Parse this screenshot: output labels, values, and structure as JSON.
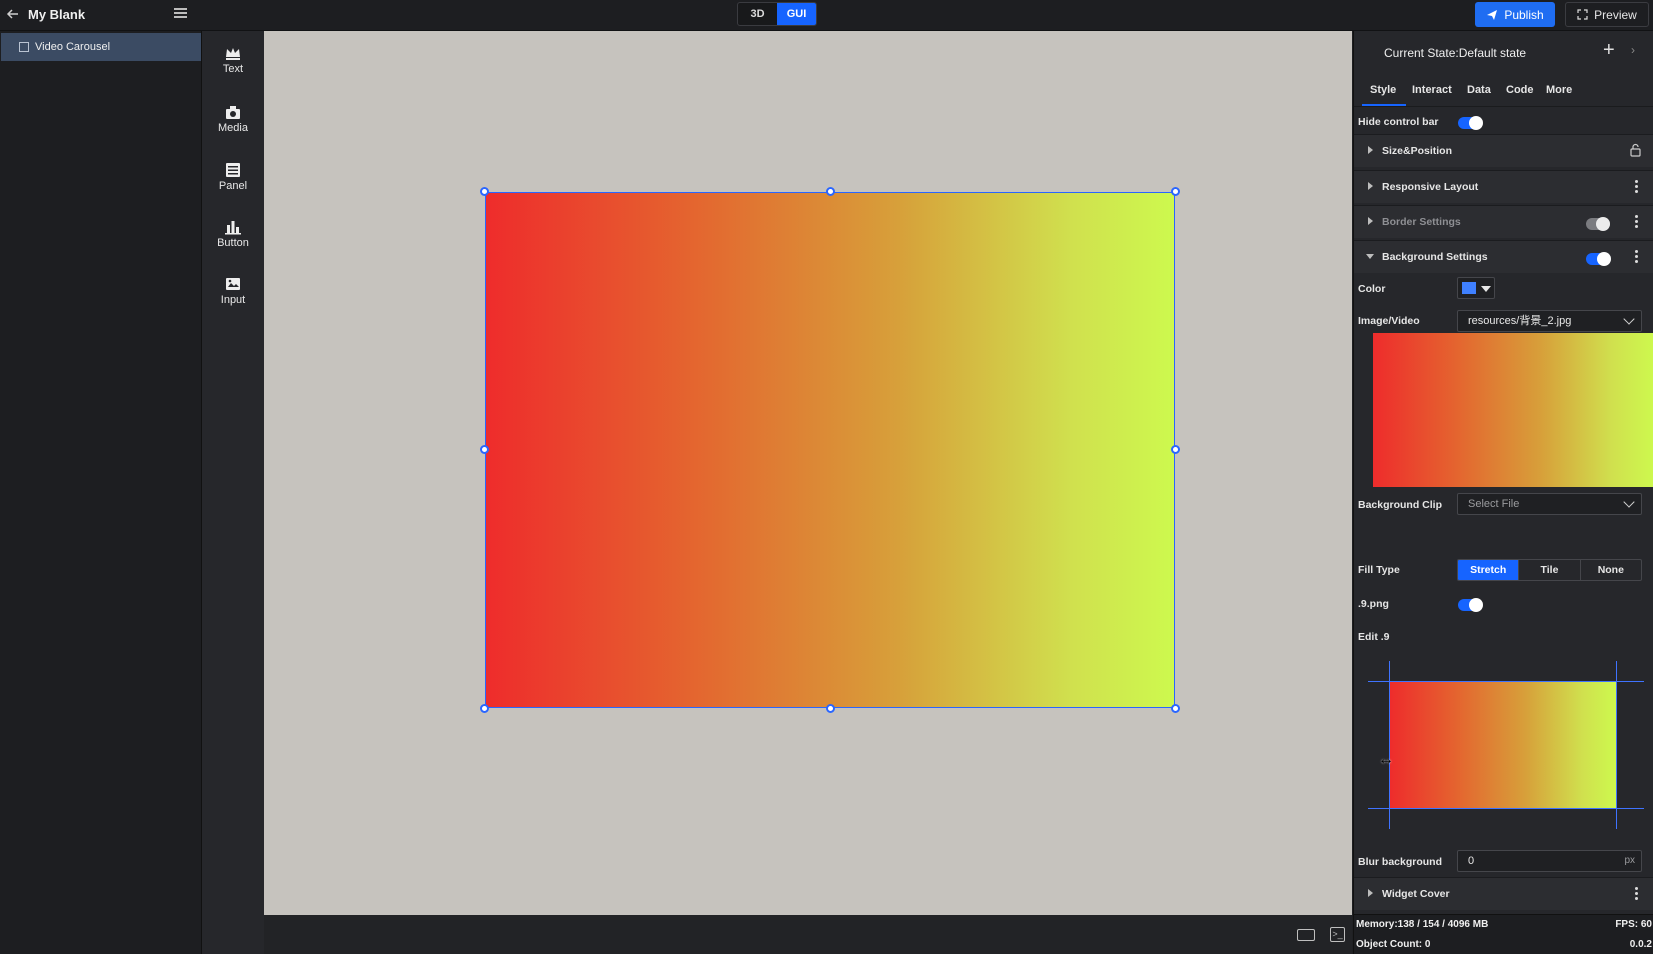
{
  "topbar": {
    "title": "My Blank",
    "mode_3d": "3D",
    "mode_gui": "GUI",
    "publish_label": "Publish",
    "preview_label": "Preview"
  },
  "layers": {
    "items": [
      {
        "label": "Video Carousel"
      }
    ]
  },
  "widgets": {
    "items": [
      {
        "label": "Text",
        "icon": "text-crown-icon"
      },
      {
        "label": "Media",
        "icon": "media-icon"
      },
      {
        "label": "Panel",
        "icon": "panel-icon"
      },
      {
        "label": "Button",
        "icon": "button-icon"
      },
      {
        "label": "Input",
        "icon": "input-icon"
      }
    ]
  },
  "props": {
    "state_label": "Current State:Default state",
    "tabs": [
      "Style",
      "Interact",
      "Data",
      "Code",
      "More"
    ],
    "hide_control_bar": "Hide control bar",
    "sections": {
      "size_position": "Size&Position",
      "responsive": "Responsive Layout",
      "border": "Border Settings",
      "background": "Background Settings",
      "widget_cover": "Widget Cover"
    },
    "color_label": "Color",
    "color_value": "#3f80ff",
    "image_label": "Image/Video",
    "image_value": "resources/背景_2.jpg",
    "clip_label": "Background Clip",
    "clip_placeholder": "Select File",
    "fill_label": "Fill Type",
    "fill_options": [
      "Stretch",
      "Tile",
      "None"
    ],
    "fill_selected": "Stretch",
    "nine_png_label": ".9.png",
    "edit9_label": "Edit .9",
    "blur_label": "Blur background",
    "blur_value": "0",
    "blur_unit": "px"
  },
  "status": {
    "memory": "Memory:138 / 154 / 4096 MB",
    "fps": "FPS: 60",
    "object_count": "Object Count: 0",
    "version": "0.0.2"
  },
  "colors": {
    "accent": "#1664ff",
    "canvas_bg": "#c6c3be",
    "gradient_start": "#ee2c2c",
    "gradient_end": "#cdf94e"
  }
}
